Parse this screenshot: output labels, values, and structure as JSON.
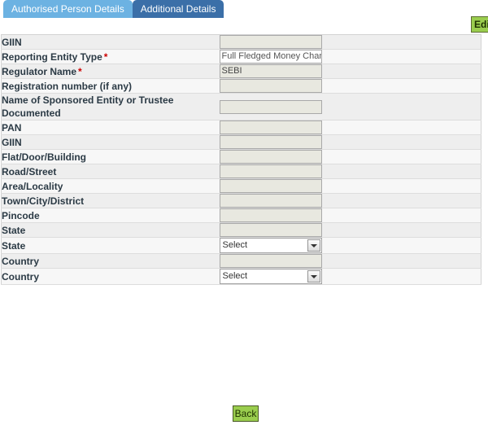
{
  "tabs": [
    {
      "label": "Authorised Person Details",
      "active": false
    },
    {
      "label": "Additional Details",
      "active": true
    }
  ],
  "toolbar": {
    "edit_label": "Edit"
  },
  "footer": {
    "back_label": "Back"
  },
  "form": {
    "rows": [
      {
        "label": "GIIN",
        "required": false,
        "type": "text",
        "value": ""
      },
      {
        "label": "Reporting Entity Type",
        "required": true,
        "type": "text",
        "value": "Full Fledged Money Chang",
        "white": true
      },
      {
        "label": "Regulator Name",
        "required": true,
        "type": "text",
        "value": "SEBI"
      },
      {
        "label": "Registration number (if any)",
        "required": false,
        "type": "text",
        "value": ""
      },
      {
        "label": "Name of Sponsored Entity or Trustee Documented",
        "required": false,
        "type": "text",
        "value": ""
      },
      {
        "label": "PAN",
        "required": false,
        "type": "text",
        "value": ""
      },
      {
        "label": "GIIN",
        "required": false,
        "type": "text",
        "value": ""
      },
      {
        "label": "Flat/Door/Building",
        "required": false,
        "type": "text",
        "value": ""
      },
      {
        "label": "Road/Street",
        "required": false,
        "type": "text",
        "value": ""
      },
      {
        "label": "Area/Locality",
        "required": false,
        "type": "text",
        "value": ""
      },
      {
        "label": "Town/City/District",
        "required": false,
        "type": "text",
        "value": ""
      },
      {
        "label": "Pincode",
        "required": false,
        "type": "text",
        "value": ""
      },
      {
        "label": "State",
        "required": false,
        "type": "text",
        "value": ""
      },
      {
        "label": "State",
        "required": false,
        "type": "select",
        "value": "Select"
      },
      {
        "label": "Country",
        "required": false,
        "type": "text",
        "value": ""
      },
      {
        "label": "Country",
        "required": false,
        "type": "select",
        "value": "Select"
      }
    ]
  }
}
